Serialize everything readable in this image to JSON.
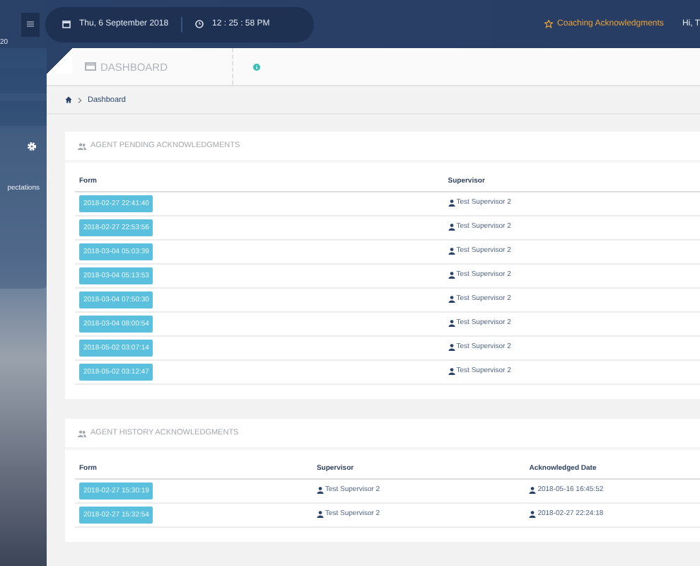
{
  "topbar": {
    "date": "Thu, 6 September 2018",
    "time": "12 : 25 : 58 PM",
    "link": "Coaching Acknowledgments",
    "greeting": "Hi, T"
  },
  "sidebar": {
    "label": "20",
    "item": "pectations"
  },
  "page": {
    "title": "DASHBOARD",
    "breadcrumb": "Dashboard"
  },
  "sections": [
    {
      "title": "AGENT PENDING ACKNOWLEDGMENTS",
      "columns": [
        {
          "label": "Form",
          "kind": "badge"
        },
        {
          "label": "Supervisor",
          "kind": "person"
        }
      ],
      "rows": [
        [
          "2018-02-27 22:41:40",
          "Test Supervisor 2"
        ],
        [
          "2018-02-27 22:53:56",
          "Test Supervisor 2"
        ],
        [
          "2018-03-04 05:03:39",
          "Test Supervisor 2"
        ],
        [
          "2018-03-04 05:13:53",
          "Test Supervisor 2"
        ],
        [
          "2018-03-04 07:50:30",
          "Test Supervisor 2"
        ],
        [
          "2018-03-04 08:00:54",
          "Test Supervisor 2"
        ],
        [
          "2018-05-02 03:07:14",
          "Test Supervisor 2"
        ],
        [
          "2018-05-02 03:12:47",
          "Test Supervisor 2"
        ]
      ]
    },
    {
      "title": "AGENT HISTORY ACKNOWLEDGMENTS",
      "columns": [
        {
          "label": "Form",
          "kind": "badge"
        },
        {
          "label": "Supervisor",
          "kind": "person"
        },
        {
          "label": "Acknowledged Date",
          "kind": "person"
        }
      ],
      "rows": [
        [
          "2018-02-27 15:30:19",
          "Test Supervisor 2",
          "2018-05-16 16:45:52"
        ],
        [
          "2018-02-27 15:32:54",
          "Test Supervisor 2",
          "2018-02-27 22:24:18"
        ]
      ]
    }
  ]
}
